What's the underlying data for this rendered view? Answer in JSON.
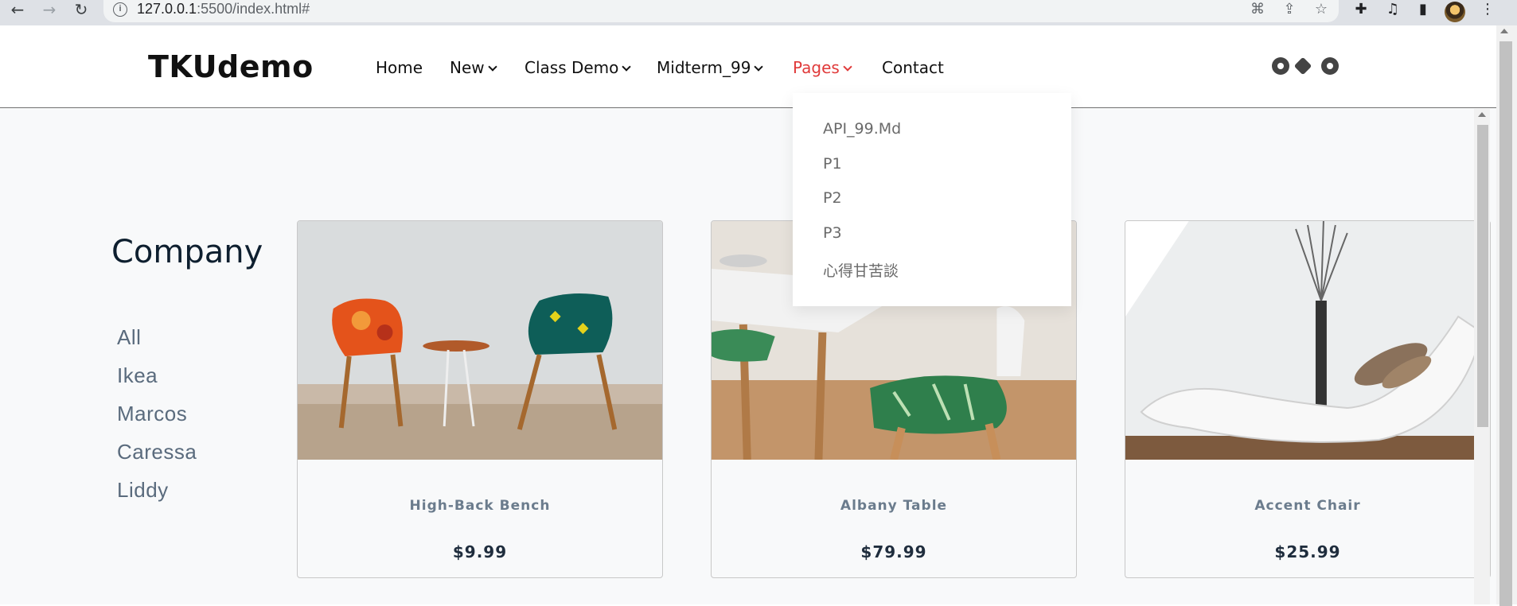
{
  "browser": {
    "url_host": "127.0.0.1",
    "url_rest": ":5500/index.html#",
    "icons": [
      "back-arrow-icon",
      "forward-arrow-icon",
      "reload-icon",
      "info-icon",
      "translate-icon",
      "share-icon",
      "star-icon",
      "extensions-icon",
      "media-icon",
      "sidepanel-icon",
      "profile-avatar",
      "kebab-menu-icon"
    ]
  },
  "header": {
    "logo": "TKUdemo",
    "menu": [
      {
        "label": "Home",
        "dropdown": false
      },
      {
        "label": "New",
        "dropdown": true
      },
      {
        "label": "Class Demo",
        "dropdown": true
      },
      {
        "label": "Midterm_99",
        "dropdown": true
      },
      {
        "label": "Pages",
        "dropdown": true,
        "active": true
      },
      {
        "label": "Contact",
        "dropdown": false
      }
    ],
    "icons": [
      "github-icon",
      "git-icon",
      "gear-icon"
    ],
    "active_color": "#e03a3a"
  },
  "dropdown": {
    "items": [
      "API_99.Md",
      "P1",
      "P2",
      "P3",
      "心得甘苦談"
    ]
  },
  "sidebar": {
    "title": "Company",
    "filters": [
      "All",
      "Ikea",
      "Marcos",
      "Caressa",
      "Liddy"
    ]
  },
  "products": [
    {
      "name": "High-Back Bench",
      "price": "$9.99"
    },
    {
      "name": "Albany Table",
      "price": "$79.99"
    },
    {
      "name": "Accent Chair",
      "price": "$25.99"
    }
  ]
}
